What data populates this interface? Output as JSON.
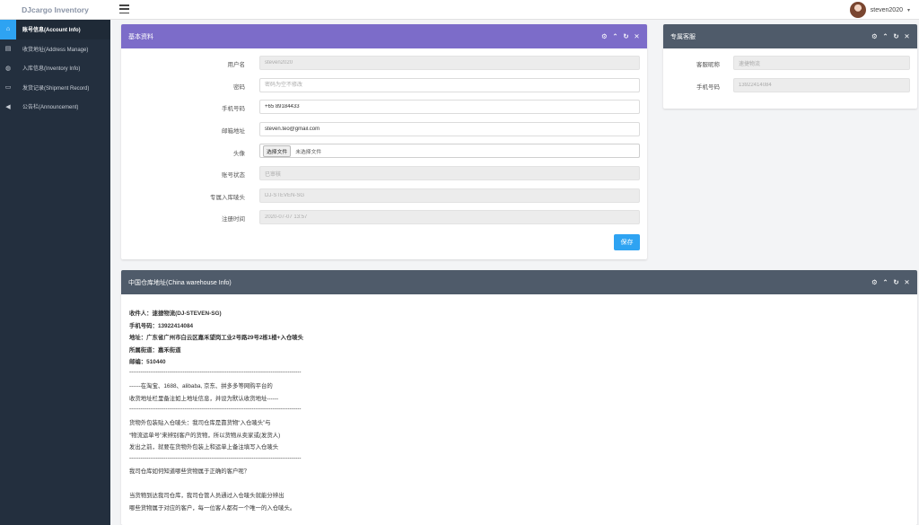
{
  "app": {
    "brand": "DJcargo Inventory"
  },
  "header": {
    "username": "steven2020",
    "caret": "▾"
  },
  "sidebar": {
    "items": [
      {
        "icon": "⌂",
        "label": "账号信息(Account Info)"
      },
      {
        "icon": "▤",
        "label": "收货地址(Address Manage)"
      },
      {
        "icon": "◍",
        "label": "入库信息(Inventory Info)"
      },
      {
        "icon": "▭",
        "label": "发货记录(Shipment Record)"
      },
      {
        "icon": "◀",
        "label": "公告栏(Announcement)"
      }
    ]
  },
  "basic": {
    "title": "基本资料",
    "tools": [
      "⚙",
      "⌃",
      "↻",
      "✕"
    ],
    "fields": {
      "username": {
        "label": "用户名",
        "value": "steven2020"
      },
      "password": {
        "label": "密码",
        "placeholder": "密码为空不修改"
      },
      "phone": {
        "label": "手机号码",
        "value": "+65 89184433"
      },
      "email": {
        "label": "邮箱地址",
        "value": "steven.teo@gmail.com"
      },
      "avatar": {
        "label": "头像",
        "button": "选择文件",
        "status": "未选择文件"
      },
      "status": {
        "label": "账号状态",
        "value": "已审核"
      },
      "warehouse_code": {
        "label": "专属入库唛头",
        "value": "DJ-STEVEN-SG"
      },
      "register_time": {
        "label": "注册时间",
        "value": "2020-07-07 13:57"
      }
    },
    "save_label": "保存"
  },
  "service": {
    "title": "专属客服",
    "tools": [
      "⚙",
      "⌃",
      "↻",
      "✕"
    ],
    "nickname": {
      "label": "客服昵称",
      "value": "速捷物流"
    },
    "phone": {
      "label": "手机号码",
      "value": "13922414084"
    }
  },
  "china": {
    "title": "中国仓库地址(China warehouse Info)",
    "tools": [
      "⚙",
      "⌃",
      "↻",
      "✕"
    ],
    "lines": [
      "收件人：速捷物流(DJ-STEVEN-SG)",
      "手机号码：13922414084",
      "地址：广东省广州市白云区嘉禾望岗工业2号路29号2栋1楼+入仓唛头",
      "所属街道：嘉禾街道",
      "邮编：510440",
      "------------------------------------------------------------------------------------------",
      "------在淘宝、1688、alibaba, 京东、拼多多等网购平台的",
      "收货地址栏里备注如上地址信息，并设为默认收货地址------",
      "------------------------------------------------------------------------------------------",
      "货物外包装贴入仓唛头：我司仓库是靠货物“入仓唛头”与",
      "“物流运单号”来辨别客户的货物，所以货物从卖家或(发货人)",
      "发出之前，就要在货物外包装上和运单上备注填写入仓唛头",
      "------------------------------------------------------------------------------------------",
      "我司仓库如何知道哪些货物属于正确的客户呢？",
      "当货物到达我司仓库，我司仓管人员通过入仓唛头就能分辨出",
      "哪些货物属于对应的客户，每一位客人都有一个唯一的入仓唛头。"
    ]
  }
}
